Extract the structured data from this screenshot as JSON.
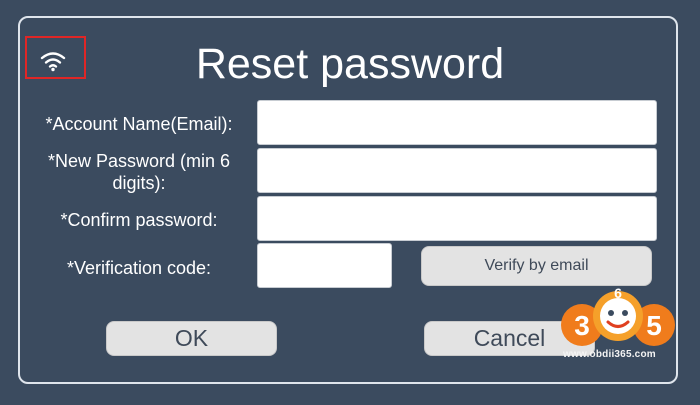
{
  "dialog": {
    "title": "Reset password",
    "status_icon": "wifi-icon",
    "fields": {
      "account_label": "*Account Name(Email):",
      "account_value": "",
      "new_password_label_line1": "*New Password (min 6",
      "new_password_label_line2": "digits):",
      "new_password_value": "",
      "confirm_label": "*Confirm password:",
      "confirm_value": "",
      "code_label": "*Verification code:",
      "code_value": ""
    },
    "buttons": {
      "verify": "Verify by email",
      "ok": "OK",
      "cancel": "Cancel"
    }
  },
  "watermark": {
    "logo_digit_1": "3",
    "logo_digit_2": "6",
    "logo_digit_3": "5",
    "url": "www.obdii365.com"
  },
  "colors": {
    "background": "#3b4b5f",
    "highlight_box": "#e02626",
    "button_bg": "#e3e3e3",
    "logo_orange": "#f07c1c"
  }
}
